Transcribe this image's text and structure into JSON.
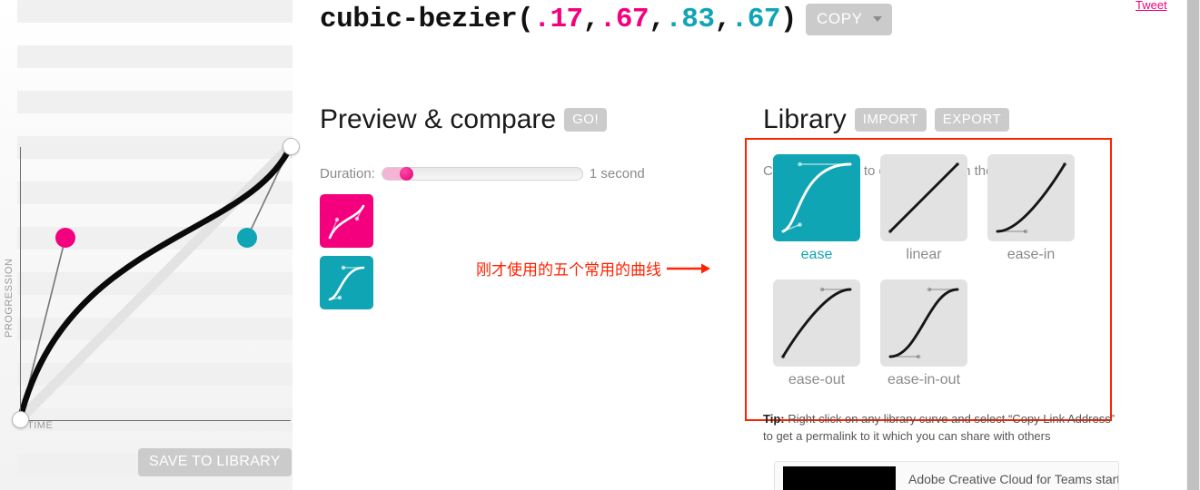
{
  "title": {
    "prefix": "cubic-bezier(",
    "p1x": ".17",
    "comma1": ",",
    "p1y": ".67",
    "comma2": ",",
    "p2x": ".83",
    "comma3": ",",
    "p2y": ".67",
    "suffix": ")"
  },
  "copy_button": {
    "label": "COPY"
  },
  "curve_editor": {
    "y_axis_label": "PROGRESSION",
    "x_axis_label": "TIME",
    "save_button": "SAVE TO LIBRARY",
    "handle_colors": {
      "p1": "#f4007f",
      "p2": "#10a5b5"
    },
    "control_points": {
      "p1x": 0.17,
      "p1y": 0.67,
      "p2x": 0.83,
      "p2y": 0.67
    }
  },
  "preview": {
    "title": "Preview & compare",
    "go_button": "GO!",
    "duration_label": "Duration:",
    "duration_value": "1 second",
    "duration_percent": 13
  },
  "library": {
    "title": "Library",
    "import_button": "IMPORT",
    "export_button": "EXPORT",
    "subtitle": "Click on a curve to compare it with the current one.",
    "items": [
      {
        "label": "ease",
        "selected": true,
        "p": [
          0.25,
          0.1,
          0.25,
          1.0
        ]
      },
      {
        "label": "linear",
        "selected": false,
        "p": [
          0.0,
          0.0,
          1.0,
          1.0
        ]
      },
      {
        "label": "ease-in",
        "selected": false,
        "p": [
          0.42,
          0.0,
          1.0,
          1.0
        ]
      },
      {
        "label": "ease-out",
        "selected": false,
        "p": [
          0.0,
          0.0,
          0.58,
          1.0
        ]
      },
      {
        "label": "ease-in-out",
        "selected": false,
        "p": [
          0.42,
          0.0,
          0.58,
          1.0
        ]
      }
    ],
    "tip_prefix": "Tip:",
    "tip_text": " Right click on any library curve and select “Copy Link Address” to get a permalink to it which you can share with others"
  },
  "annotation": {
    "text": "刚才使用的五个常用的曲线",
    "color": "#ff2200"
  },
  "ad": {
    "text": "Adobe Creative Cloud for Teams starting"
  },
  "tweet": {
    "label": "Tweet"
  }
}
